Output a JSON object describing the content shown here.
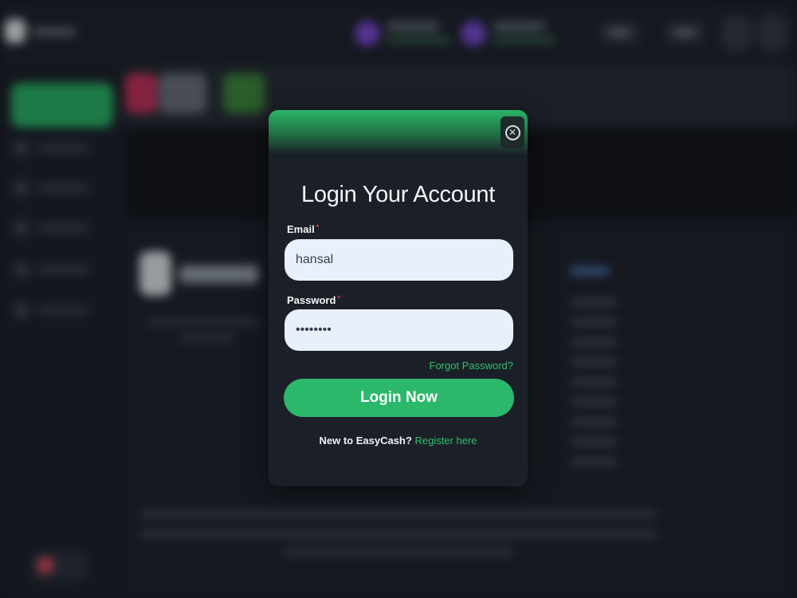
{
  "modal": {
    "title": "Login Your Account",
    "email_label": "Email",
    "email_required_mark": "*",
    "email_value": "hansal",
    "password_label": "Password",
    "password_required_mark": "*",
    "password_value": "hansal12",
    "forgot_password": "Forgot Password?",
    "login_button": "Login Now",
    "register_prompt": "New to EasyCash?",
    "register_link": "Register here",
    "close_icon": "close-icon"
  },
  "colors": {
    "accent_green": "#2bb86a",
    "modal_background": "#1b2028",
    "input_background": "#e9effc",
    "required_red": "#e04a4a"
  }
}
